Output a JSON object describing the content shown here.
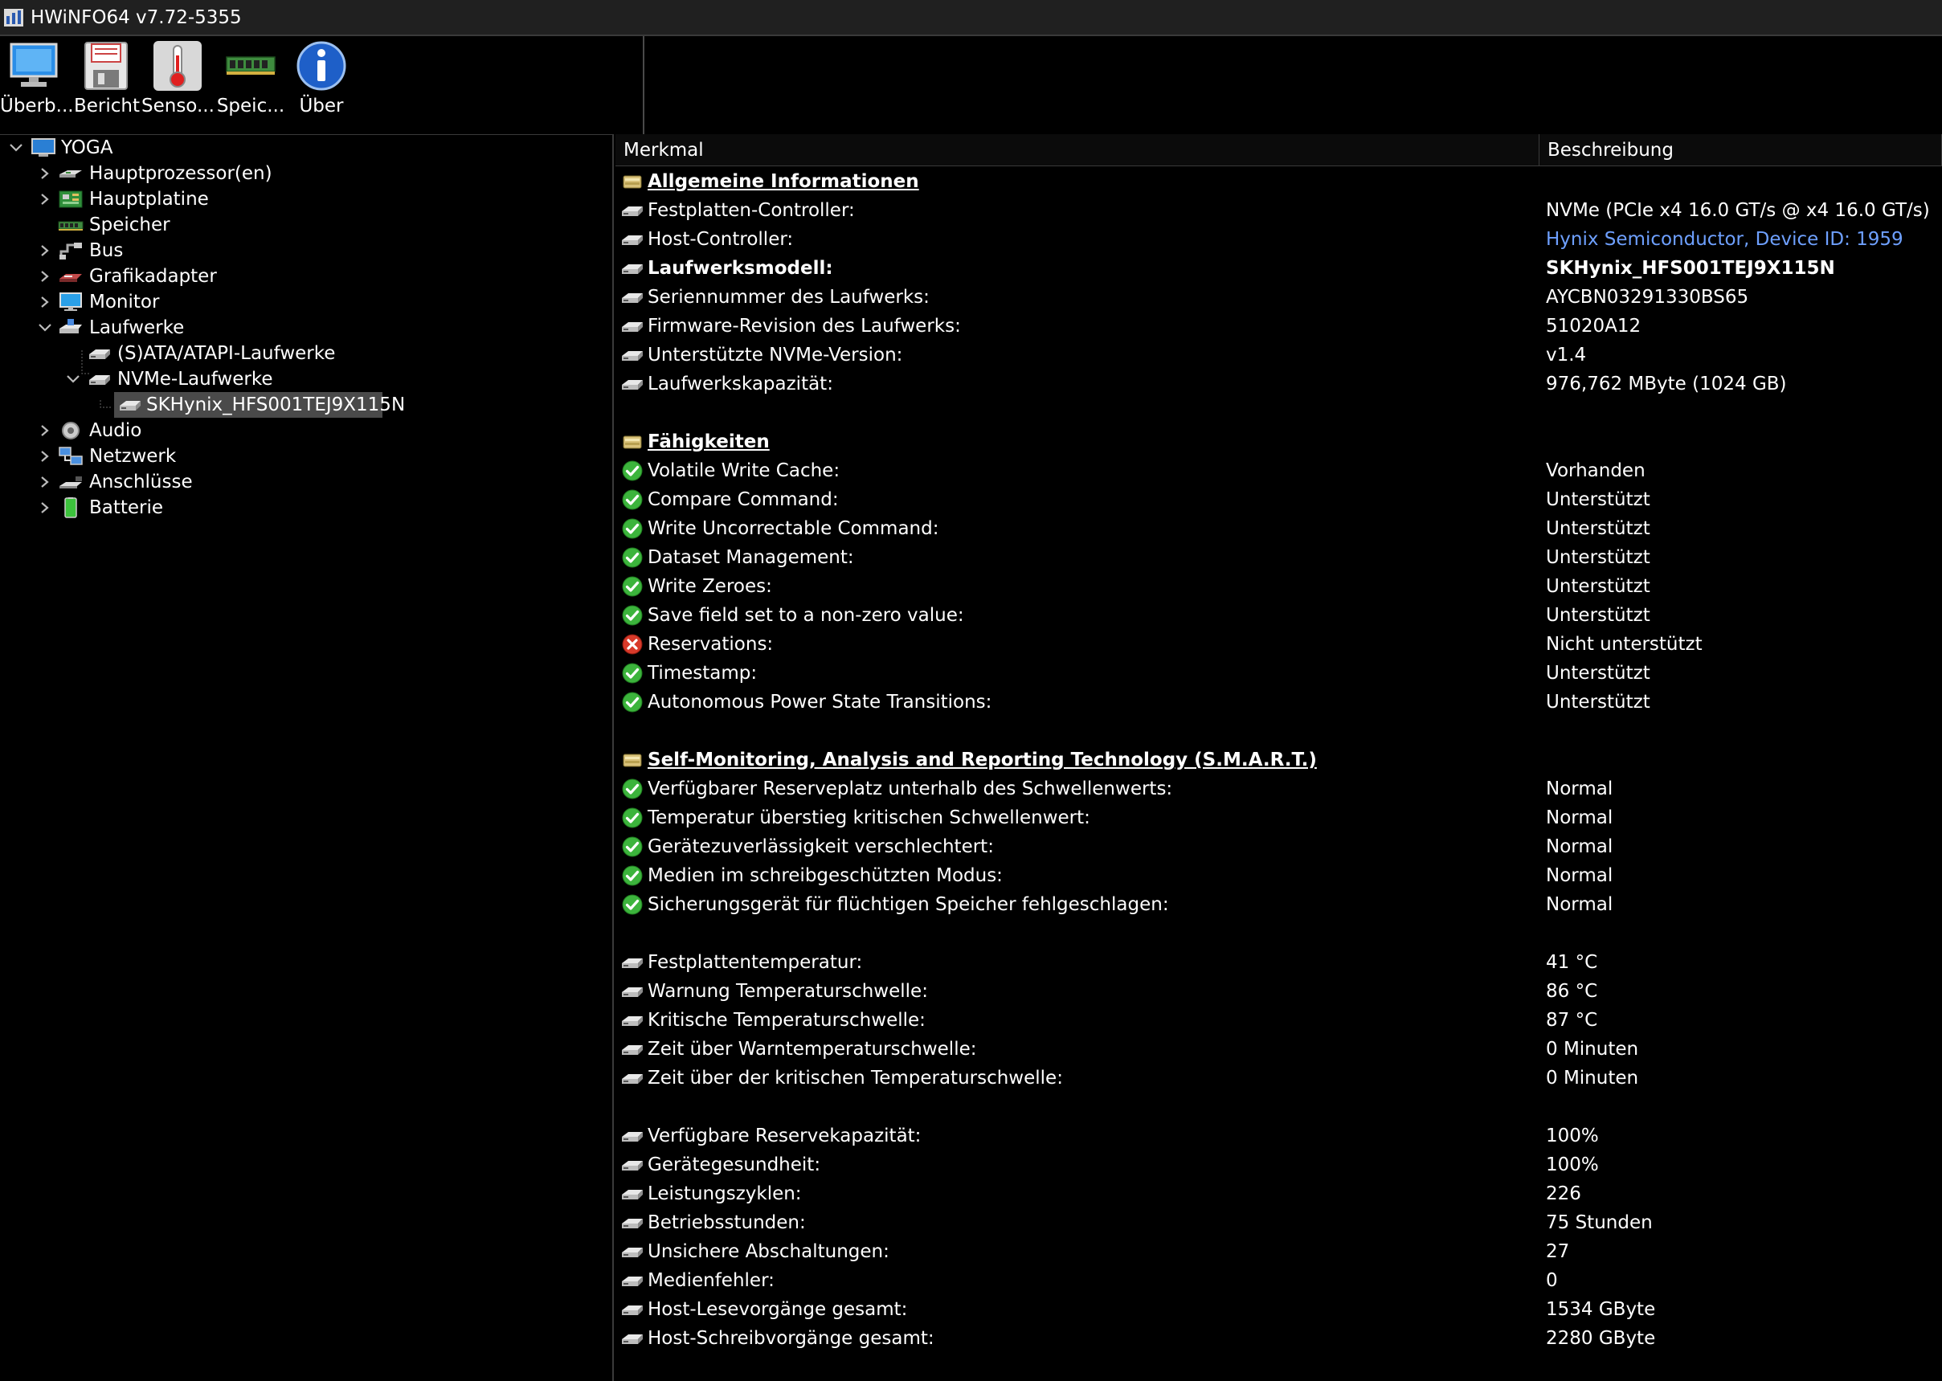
{
  "window": {
    "title": "HWiNFO64 v7.72-5355"
  },
  "toolbar": {
    "buttons": [
      {
        "label": "Überb...",
        "icon": "monitor-icon"
      },
      {
        "label": "Bericht",
        "icon": "floppy-disk-icon"
      },
      {
        "label": "Senso...",
        "icon": "thermometer-icon"
      },
      {
        "label": "Speic...",
        "icon": "memory-module-icon"
      },
      {
        "label": "Über",
        "icon": "info-icon"
      }
    ]
  },
  "tree": {
    "root": "YOGA",
    "items": [
      "Hauptprozessor(en)",
      "Hauptplatine",
      "Speicher",
      "Bus",
      "Grafikadapter",
      "Monitor",
      "Laufwerke",
      "(S)ATA/ATAPI-Laufwerke",
      "NVMe-Laufwerke",
      "SKHynix_HFS001TEJ9X115N",
      "Audio",
      "Netzwerk",
      "Anschlüsse",
      "Batterie"
    ]
  },
  "columns": {
    "feature": "Merkmal",
    "description": "Beschreibung"
  },
  "rows": [
    {
      "icon": "section-icon",
      "label": "Allgemeine Informationen",
      "value": "",
      "style": "section"
    },
    {
      "icon": "drive-icon",
      "label": "Festplatten-Controller:",
      "value": "NVMe (PCIe x4 16.0 GT/s @ x4 16.0 GT/s)"
    },
    {
      "icon": "drive-icon",
      "label": "Host-Controller:",
      "value": "Hynix Semiconductor, Device ID: 1959",
      "style": "link"
    },
    {
      "icon": "drive-icon",
      "label": "Laufwerksmodell:",
      "value": "SKHynix_HFS001TEJ9X115N",
      "style": "bold"
    },
    {
      "icon": "drive-icon",
      "label": "Seriennummer des Laufwerks:",
      "value": "AYCBN03291330BS65"
    },
    {
      "icon": "drive-icon",
      "label": "Firmware-Revision des Laufwerks:",
      "value": "51020A12"
    },
    {
      "icon": "drive-icon",
      "label": "Unterstützte NVMe-Version:",
      "value": "v1.4"
    },
    {
      "icon": "drive-icon",
      "label": "Laufwerkskapazität:",
      "value": "976,762 MByte (1024 GB)"
    },
    {
      "icon": "",
      "label": "",
      "value": ""
    },
    {
      "icon": "section-icon",
      "label": "Fähigkeiten",
      "value": "",
      "style": "section"
    },
    {
      "icon": "check-icon",
      "label": "Volatile Write Cache:",
      "value": "Vorhanden"
    },
    {
      "icon": "check-icon",
      "label": "Compare Command:",
      "value": "Unterstützt"
    },
    {
      "icon": "check-icon",
      "label": "Write Uncorrectable Command:",
      "value": "Unterstützt"
    },
    {
      "icon": "check-icon",
      "label": "Dataset Management:",
      "value": "Unterstützt"
    },
    {
      "icon": "check-icon",
      "label": "Write Zeroes:",
      "value": "Unterstützt"
    },
    {
      "icon": "check-icon",
      "label": "Save field set to a non-zero value:",
      "value": "Unterstützt"
    },
    {
      "icon": "cross-icon",
      "label": "Reservations:",
      "value": "Nicht unterstützt"
    },
    {
      "icon": "check-icon",
      "label": "Timestamp:",
      "value": "Unterstützt"
    },
    {
      "icon": "check-icon",
      "label": "Autonomous Power State Transitions:",
      "value": "Unterstützt"
    },
    {
      "icon": "",
      "label": "",
      "value": ""
    },
    {
      "icon": "section-icon",
      "label": "Self-Monitoring, Analysis and Reporting Technology (S.M.A.R.T.)",
      "value": "",
      "style": "section"
    },
    {
      "icon": "check-icon",
      "label": "Verfügbarer Reserveplatz unterhalb des Schwellenwerts:",
      "value": "Normal"
    },
    {
      "icon": "check-icon",
      "label": "Temperatur überstieg kritischen Schwellenwert:",
      "value": "Normal"
    },
    {
      "icon": "check-icon",
      "label": "Gerätezuverlässigkeit verschlechtert:",
      "value": "Normal"
    },
    {
      "icon": "check-icon",
      "label": "Medien im schreibgeschützten Modus:",
      "value": "Normal"
    },
    {
      "icon": "check-icon",
      "label": "Sicherungsgerät für flüchtigen Speicher fehlgeschlagen:",
      "value": "Normal"
    },
    {
      "icon": "",
      "label": "",
      "value": ""
    },
    {
      "icon": "drive-icon",
      "label": "Festplattentemperatur:",
      "value": "41 °C"
    },
    {
      "icon": "drive-icon",
      "label": "Warnung Temperaturschwelle:",
      "value": "86 °C"
    },
    {
      "icon": "drive-icon",
      "label": "Kritische Temperaturschwelle:",
      "value": "87 °C"
    },
    {
      "icon": "drive-icon",
      "label": "Zeit über Warntemperaturschwelle:",
      "value": "0 Minuten"
    },
    {
      "icon": "drive-icon",
      "label": "Zeit über der kritischen Temperaturschwelle:",
      "value": "0 Minuten"
    },
    {
      "icon": "",
      "label": "",
      "value": ""
    },
    {
      "icon": "drive-icon",
      "label": "Verfügbare Reservekapazität:",
      "value": "100%"
    },
    {
      "icon": "drive-icon",
      "label": "Gerätegesundheit:",
      "value": "100%"
    },
    {
      "icon": "drive-icon",
      "label": "Leistungszyklen:",
      "value": "226"
    },
    {
      "icon": "drive-icon",
      "label": "Betriebsstunden:",
      "value": "75 Stunden"
    },
    {
      "icon": "drive-icon",
      "label": "Unsichere Abschaltungen:",
      "value": "27"
    },
    {
      "icon": "drive-icon",
      "label": "Medienfehler:",
      "value": "0"
    },
    {
      "icon": "drive-icon",
      "label": "Host-Lesevorgänge gesamt:",
      "value": "1534 GByte"
    },
    {
      "icon": "drive-icon",
      "label": "Host-Schreibvorgänge gesamt:",
      "value": "2280 GByte"
    }
  ],
  "colors": {
    "background": "#000000",
    "text": "#ffffff",
    "link": "#6ea0ff",
    "selection": "#4a4a4a",
    "check": "#3cb43c",
    "cross": "#d83a2a"
  }
}
